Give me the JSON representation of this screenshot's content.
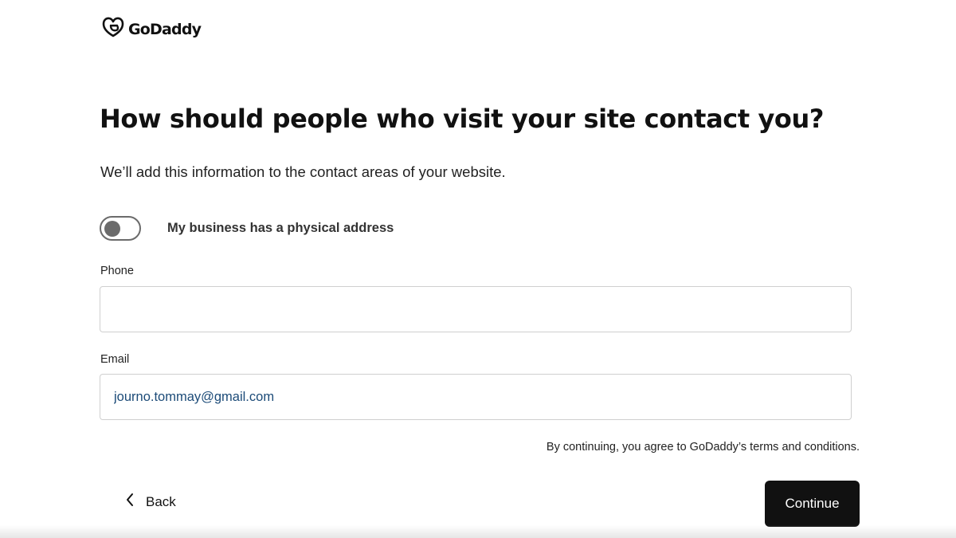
{
  "header": {
    "logo_text": "GoDaddy",
    "logo_icon": "godaddy-logo-icon"
  },
  "main": {
    "title": "How should people who visit your site contact you?",
    "subtitle": "We’ll add this information to the contact areas of your website.",
    "address_toggle": {
      "label": "My business has a physical address",
      "checked": false
    },
    "phone": {
      "label": "Phone",
      "value": "",
      "placeholder": ""
    },
    "email": {
      "label": "Email",
      "value": "journo.tommay@gmail.com",
      "placeholder": ""
    },
    "terms_text": "By continuing, you agree to GoDaddy’s terms and conditions."
  },
  "footer": {
    "back_label": "Back",
    "back_icon": "chevron-left-icon",
    "continue_label": "Continue"
  },
  "colors": {
    "primary_button": "#111111",
    "input_text": "#1c4b78",
    "toggle_off": "#6b6b6b"
  }
}
